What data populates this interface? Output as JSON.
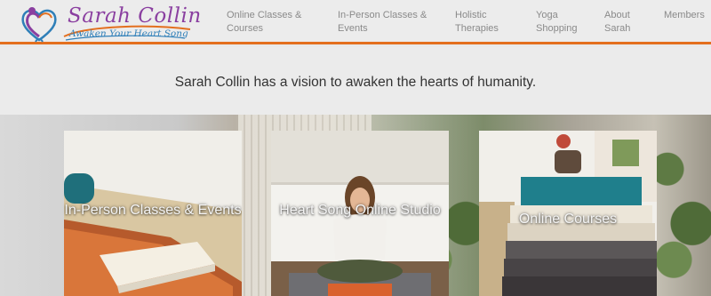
{
  "logo": {
    "name": "Sarah Collin",
    "tagline": "Awaken Your Heart Song"
  },
  "nav": [
    {
      "id": "online-classes",
      "label": "Online Classes & Courses"
    },
    {
      "id": "in-person",
      "label": "In-Person Classes & Events"
    },
    {
      "id": "holistic",
      "label": "Holistic Therapies"
    },
    {
      "id": "yoga-shopping",
      "label": "Yoga Shopping"
    },
    {
      "id": "about",
      "label": "About Sarah"
    },
    {
      "id": "members",
      "label": "Members"
    }
  ],
  "tagline": "Sarah Collin has a vision to awaken the hearts of humanity.",
  "cards": [
    {
      "label": "In-Person Classes & Events"
    },
    {
      "label": "Heart Song Online Studio"
    },
    {
      "label": "Online Courses"
    }
  ],
  "colors": {
    "accent": "#e36f1e",
    "logo_purple": "#8a3fa0",
    "logo_blue": "#2f7fb8"
  }
}
